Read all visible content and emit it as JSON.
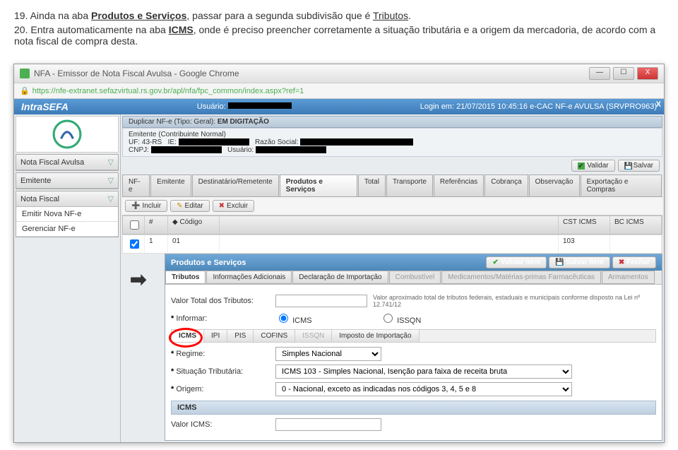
{
  "doc": {
    "line1_num": "19.",
    "line1_a": " Ainda na aba ",
    "line1_b": "Produtos e Serviços",
    "line1_c": ", passar para a segunda subdivisão que é ",
    "line1_d": "Tributos",
    "line1_e": ".",
    "line2_num": "20.",
    "line2_a": " Entra automaticamente na aba ",
    "line2_b": "ICMS",
    "line2_c": ", onde é preciso preencher corretamente a situação tributária e a origem da mercadoria, de acordo com a nota fiscal de compra desta."
  },
  "window": {
    "title": "NFA - Emissor de Nota Fiscal Avulsa - Google Chrome",
    "url": "https://nfe-extranet.sefazvirtual.rs.gov.br/apl/nfa/fpc_common/index.aspx?ref=1",
    "min": "—",
    "max": "☐",
    "close": "X"
  },
  "banner": {
    "brand": "IntraSEFA",
    "user_label": "Usuário:",
    "login": "Login em: 21/07/2015 10:45:16   e-CAC   NF-e AVULSA   (SRVPRO963)"
  },
  "sidebar": {
    "main": "Nota Fiscal Avulsa",
    "g1": "Emitente",
    "g2": "Nota Fiscal",
    "i1": "Emitir Nova NF-e",
    "i2": "Gerenciar NF-e"
  },
  "crumb": {
    "a": "Duplicar NF-e (Tipo: Geral): ",
    "b": "EM DIGITAÇÃO"
  },
  "info": {
    "l1": "Emitente (Contribuinte Normal)",
    "l2a": "UF: 43-RS",
    "l2b": "IE:",
    "l2c": "Razão Social:",
    "l3a": "CNPJ:",
    "l3b": "Usuário:"
  },
  "toolbar": {
    "validar": "Validar",
    "salvar": "Salvar"
  },
  "tabs": [
    "NF-e",
    "Emitente",
    "Destinatário/Remetente",
    "Produtos e Serviços",
    "Total",
    "Transporte",
    "Referências",
    "Cobrança",
    "Observação",
    "Exportação e Compras"
  ],
  "actions": {
    "incluir": "Incluir",
    "editar": "Editar",
    "excluir": "Excluir"
  },
  "grid": {
    "h_chk": "",
    "h_num": "#",
    "h_cod": "Código",
    "h_cst": "CST ICMS",
    "h_bc": "BC ICMS",
    "r_num": "1",
    "r_cod": "01",
    "r_cst": "103"
  },
  "panel": {
    "title": "Produtos e Serviços",
    "validar_item": "Validar Item",
    "salvar_item": "Salvar Item",
    "fechar": "Fechar"
  },
  "subtabs": [
    "Tributos",
    "Informações Adicionais",
    "Declaração de Importação",
    "Combustível",
    "Medicamentos/Matérias-primas Farmacêuticas",
    "Armamentos"
  ],
  "form": {
    "vtot_label": "Valor Total dos Tributos:",
    "vtot_note": "Valor aproximado total de tributos federais, estaduais e municipais conforme disposto na Lei nº 12.741/12",
    "informar": "Informar:",
    "opt_icms": "ICMS",
    "opt_issqn": "ISSQN",
    "regime_label": "Regime:",
    "regime_value": "Simples Nacional",
    "sit_label": "Situação Tributária:",
    "sit_value": "ICMS 103 - Simples Nacional, Isenção para faixa de receita bruta",
    "origem_label": "Origem:",
    "origem_value": "0 - Nacional, exceto as indicadas nos códigos 3, 4, 5 e 8",
    "icms_head": "ICMS",
    "valor_icms": "Valor ICMS:"
  },
  "tabs2": [
    "ICMS",
    "IPI",
    "PIS",
    "COFINS",
    "ISSQN",
    "Imposto de Importação"
  ]
}
